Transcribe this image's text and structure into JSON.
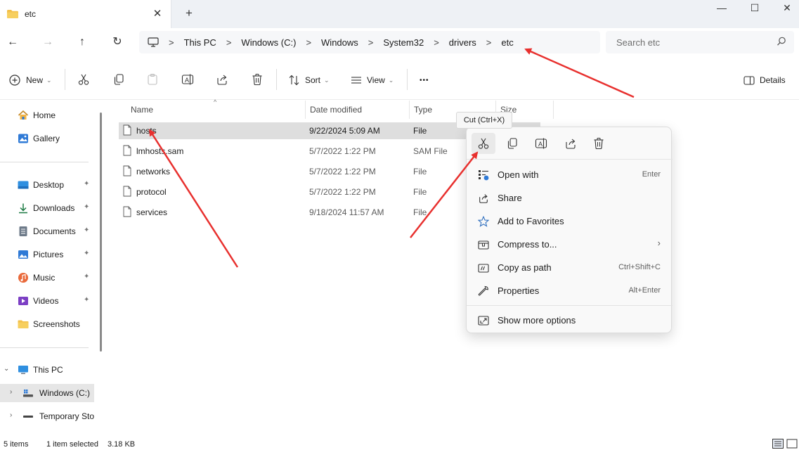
{
  "window": {
    "tab_title": "etc",
    "tab_close": "✕",
    "new_tab": "+",
    "minimize": "—",
    "maximize": "☐",
    "close": "✕"
  },
  "nav": {
    "back": "←",
    "forward": "→",
    "up": "↑",
    "refresh": "↻"
  },
  "breadcrumb": [
    "This PC",
    "Windows (C:)",
    "Windows",
    "System32",
    "drivers",
    "etc"
  ],
  "breadcrumb_separator": ">",
  "search": {
    "placeholder": "Search etc"
  },
  "toolbar": {
    "new_label": "New",
    "sort_label": "Sort",
    "view_label": "View",
    "more_label": "•••",
    "details_label": "Details"
  },
  "sidebar": {
    "quick": [
      {
        "label": "Home",
        "icon": "home-icon",
        "pinned": false
      },
      {
        "label": "Gallery",
        "icon": "gallery-icon",
        "pinned": false
      }
    ],
    "pinned": [
      {
        "label": "Desktop",
        "icon": "desktop-icon"
      },
      {
        "label": "Downloads",
        "icon": "download-icon"
      },
      {
        "label": "Documents",
        "icon": "documents-icon"
      },
      {
        "label": "Pictures",
        "icon": "pictures-icon"
      },
      {
        "label": "Music",
        "icon": "music-icon"
      },
      {
        "label": "Videos",
        "icon": "videos-icon"
      },
      {
        "label": "Screenshots",
        "icon": "folder-icon"
      }
    ],
    "pin_glyph": "📌",
    "tree": [
      {
        "label": "This PC",
        "icon": "pc-icon",
        "expanded": true
      },
      {
        "label": "Windows (C:)",
        "icon": "drive-icon",
        "selected": true
      },
      {
        "label": "Temporary Sto",
        "icon": "drive-icon"
      }
    ],
    "tree_expanded_glyph": "⌄",
    "tree_collapsed_glyph": "›"
  },
  "columns": {
    "name": "Name",
    "date": "Date modified",
    "type": "Type",
    "size": "Size"
  },
  "files": [
    {
      "name": "hosts",
      "date": "9/22/2024 5:09 AM",
      "type": "File",
      "selected": true
    },
    {
      "name": "lmhosts.sam",
      "date": "5/7/2022 1:22 PM",
      "type": "SAM File",
      "selected": false
    },
    {
      "name": "networks",
      "date": "5/7/2022 1:22 PM",
      "type": "File",
      "selected": false
    },
    {
      "name": "protocol",
      "date": "5/7/2022 1:22 PM",
      "type": "File",
      "selected": false
    },
    {
      "name": "services",
      "date": "9/18/2024 11:57 AM",
      "type": "File",
      "selected": false
    }
  ],
  "tooltip": "Cut (Ctrl+X)",
  "context_menu": {
    "items": [
      {
        "label": "Open with",
        "shortcut": "Enter",
        "icon": "open-with-icon"
      },
      {
        "label": "Share",
        "shortcut": "",
        "icon": "share-icon"
      },
      {
        "label": "Add to Favorites",
        "shortcut": "",
        "icon": "star-icon"
      },
      {
        "label": "Compress to...",
        "shortcut": "›",
        "icon": "compress-icon"
      },
      {
        "label": "Copy as path",
        "shortcut": "Ctrl+Shift+C",
        "icon": "copy-path-icon"
      },
      {
        "label": "Properties",
        "shortcut": "Alt+Enter",
        "icon": "wrench-icon"
      }
    ],
    "more_options": {
      "label": "Show more options",
      "icon": "more-options-icon"
    }
  },
  "status": {
    "items_count": "5 items",
    "selection": "1 item selected",
    "size": "3.18 KB"
  },
  "colors": {
    "accent": "#0067c0",
    "annotation_arrow": "#e8302e",
    "folder": "#f3c04b",
    "selection": "#dedede"
  }
}
